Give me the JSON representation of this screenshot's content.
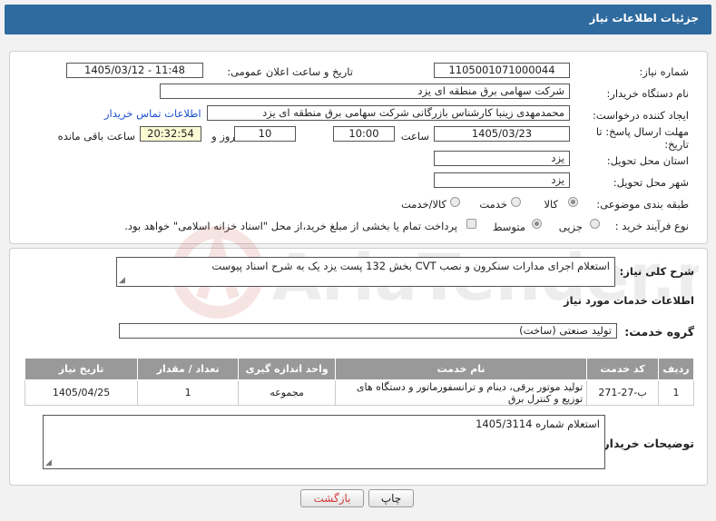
{
  "header": {
    "title": "جزئیات اطلاعات نیاز"
  },
  "labels": {
    "need_number": "شماره نیاز:",
    "announce_datetime": "تاریخ و ساعت اعلان عمومی:",
    "buyer_org": "نام دستگاه خریدار:",
    "requester": "ایجاد کننده درخواست:",
    "deadline": "مهلت ارسال پاسخ: تا تاریخ:",
    "hour": "ساعت",
    "days_and": "روز و",
    "remaining": "ساعت باقی مانده",
    "province": "استان محل تحویل:",
    "city": "شهر محل تحویل:",
    "category": "طبقه بندی موضوعی:",
    "process_type": "نوع فرآیند خرید :",
    "summary": "شرح کلی نیاز:",
    "services_info": "اطلاعات خدمات مورد نیاز",
    "service_group": "گروه خدمت:",
    "buyer_notes": "توضیحات خریدار:"
  },
  "values": {
    "need_number": "1105001071000044",
    "announce_datetime": "1405/03/12 - 11:48",
    "buyer_org": "شرکت سهامی برق منطقه ای یزد",
    "requester": "محمدمهدی زینبا کارشناس بازرگانی شرکت سهامی برق منطقه ای یزد",
    "contact_link": "اطلاعات تماس خریدار",
    "deadline_date": "1405/03/23",
    "deadline_time": "10:00",
    "days": "10",
    "remaining_time": "20:32:54",
    "province": "یزد",
    "city": "یزد",
    "summary": "استعلام اجرای مدارات سنکرون و نصب CVT بخش 132 پست یزد یک به شرح اسناد پیوست",
    "service_group": "تولید صنعتی (ساخت)",
    "buyer_notes": "استعلام شماره 1405/3114"
  },
  "category_options": [
    {
      "label": "کالا",
      "selected": true
    },
    {
      "label": "خدمت",
      "selected": false
    },
    {
      "label": "کالا/خدمت",
      "selected": false
    }
  ],
  "process_options": [
    {
      "label": "جزیی",
      "selected": false
    },
    {
      "label": "متوسط",
      "selected": true
    }
  ],
  "treasury_note": "پرداخت تمام یا بخشی از مبلغ خرید،از محل \"اسناد خزانه اسلامی\" خواهد بود.",
  "table": {
    "headers": [
      "ردیف",
      "کد خدمت",
      "نام خدمت",
      "واحد اندازه گیری",
      "تعداد / مقدار",
      "تاریخ نیاز"
    ],
    "rows": [
      [
        "1",
        "ب-27-271",
        "تولید موتور برقی، دینام و ترانسفورماتور و دستگاه های توزیع و کنترل برق",
        "مجموعه",
        "1",
        "1405/04/25"
      ]
    ]
  },
  "buttons": {
    "print": "چاپ",
    "back": "بازگشت"
  },
  "watermark": {
    "text": "AriaTender.net"
  },
  "colors": {
    "header_bg": "#2f6b9f",
    "link": "#1a4fd1",
    "back_text": "#d23c3c",
    "table_header": "#999999"
  }
}
